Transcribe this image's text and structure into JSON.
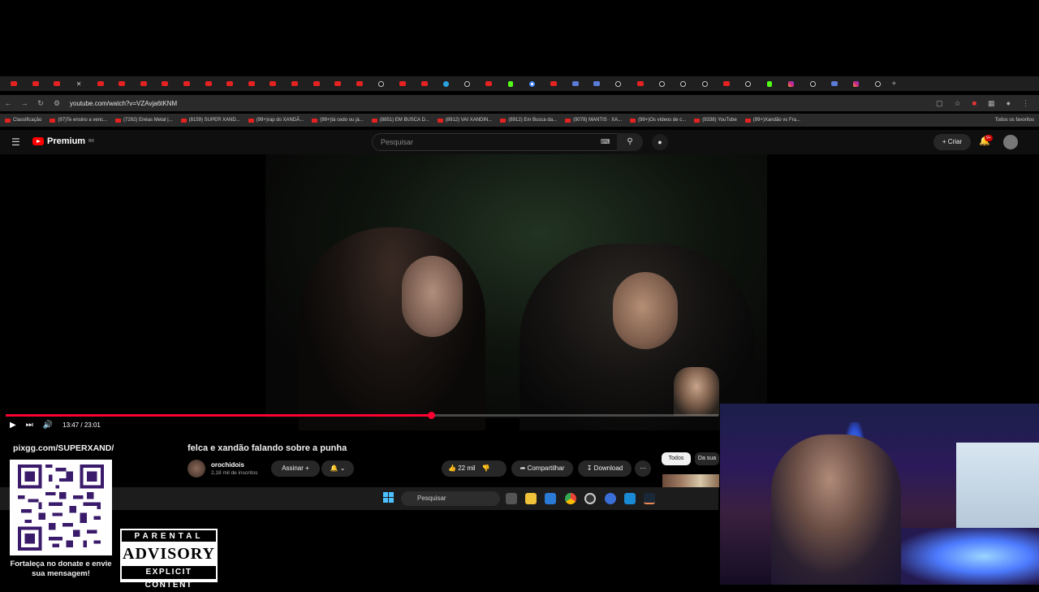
{
  "browser": {
    "tab_favicons": [
      "yt",
      "yt",
      "yt",
      "x",
      "yt",
      "yt",
      "yt",
      "yt",
      "yt",
      "yt",
      "yt",
      "yt",
      "yt",
      "yt",
      "yt",
      "yt",
      "yt",
      "tt",
      "yt",
      "yt",
      "tg",
      "tt",
      "yt",
      "kick",
      "g",
      "yt",
      "gen",
      "gen",
      "tt",
      "yt",
      "tt",
      "tt",
      "tt",
      "yt",
      "tt",
      "kick",
      "ig",
      "tt",
      "gen",
      "ig",
      "tt"
    ],
    "url": "youtube.com/watch?v=VZAvja6tKNM",
    "bookmarks": [
      "Classificação",
      "(97)Te ensino a venc...",
      "(7292) Enéas Metal |...",
      "(8159) SUPER XAND...",
      "(99+)rap do XANDÃ...",
      "(99+)tá cedo ou já...",
      "(8851) EM BUSCA D...",
      "(8912) VAI XANDIN...",
      "(8912) Em Busca da...",
      "(9078) MANTIS · XA...",
      "(99+)Os vídeos de c...",
      "(9338) YouTube",
      "(99+)Xandão vs Fra..."
    ],
    "all_favorites": "Todos os favoritos"
  },
  "youtube": {
    "logo_text": "Premium",
    "logo_region": "BR",
    "search_placeholder": "Pesquisar",
    "create_label": "Criar",
    "notif_badge": "9+",
    "player": {
      "time": "13:47 / 23:01",
      "progress_fraction": 0.597
    },
    "video_title": "felca e xandão falando sobre a punha",
    "channel_name": "orochidois",
    "channel_subs": "2,18 mil de inscritos",
    "subscribe_label": "Assinar",
    "likes": "22 mil",
    "share_label": "Compartilhar",
    "download_label": "Download",
    "chip_all": "Todos",
    "chip_yours": "Da sua"
  },
  "taskbar": {
    "search_placeholder": "Pesquisar"
  },
  "overlay": {
    "pix_url": "pixgg.com/SUPERXAND/",
    "pix_caption": "Fortaleça no donate e envie sua mensagem!",
    "advisory_top": "PARENTAL",
    "advisory_mid": "ADVISORY",
    "advisory_bottom": "EXPLICIT CONTENT"
  }
}
